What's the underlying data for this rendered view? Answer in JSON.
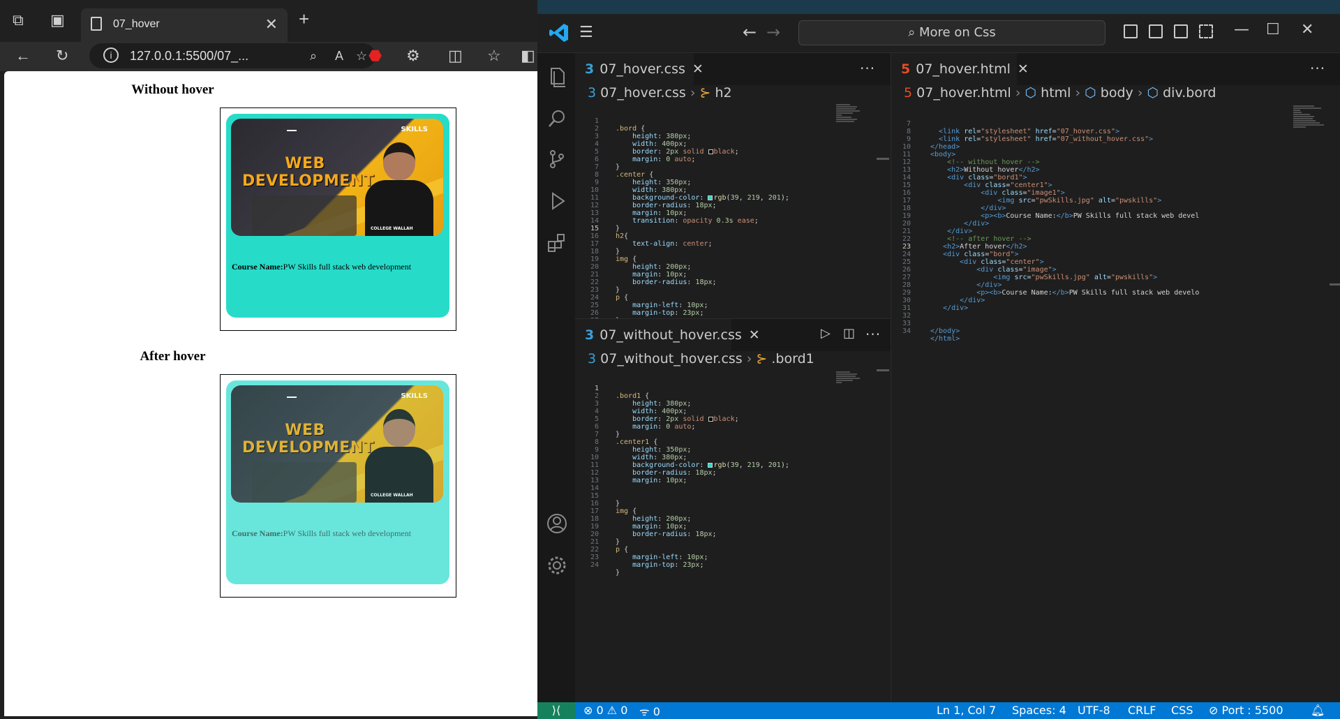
{
  "browser": {
    "tab_title": "07_hover",
    "url": "127.0.0.1:5500/07_...",
    "page": {
      "heading_without": "Without hover",
      "heading_after": "After hover",
      "thumb_title": "WEB DEVELOPMENT",
      "thumb_logo": "SKILLS",
      "thumb_badge": "COLLEGE WALLAH",
      "course_label": "Course Name:",
      "course_value": "PW Skills full stack web development"
    }
  },
  "vscode": {
    "command_center": "More on Css",
    "pane_left_top": {
      "tab": "07_hover.css",
      "crumb_file": "07_hover.css",
      "crumb_symbol": "h2",
      "cursor_line": 15
    },
    "pane_left_bottom": {
      "tab": "07_without_hover.css",
      "crumb_file": "07_without_hover.css",
      "crumb_symbol": ".bord1",
      "cursor_line": 1
    },
    "pane_right": {
      "tab": "07_hover.html",
      "crumb_file": "07_hover.html",
      "crumb_1": "html",
      "crumb_2": "body",
      "crumb_3": "div.bord",
      "cursor_line": 23
    },
    "status": {
      "problems_errors": "0",
      "problems_warnings": "0",
      "ports": "0",
      "position": "Ln 1, Col 7",
      "spaces": "Spaces: 4",
      "encoding": "UTF-8",
      "eol": "CRLF",
      "language": "CSS",
      "port": "Port : 5500"
    }
  }
}
